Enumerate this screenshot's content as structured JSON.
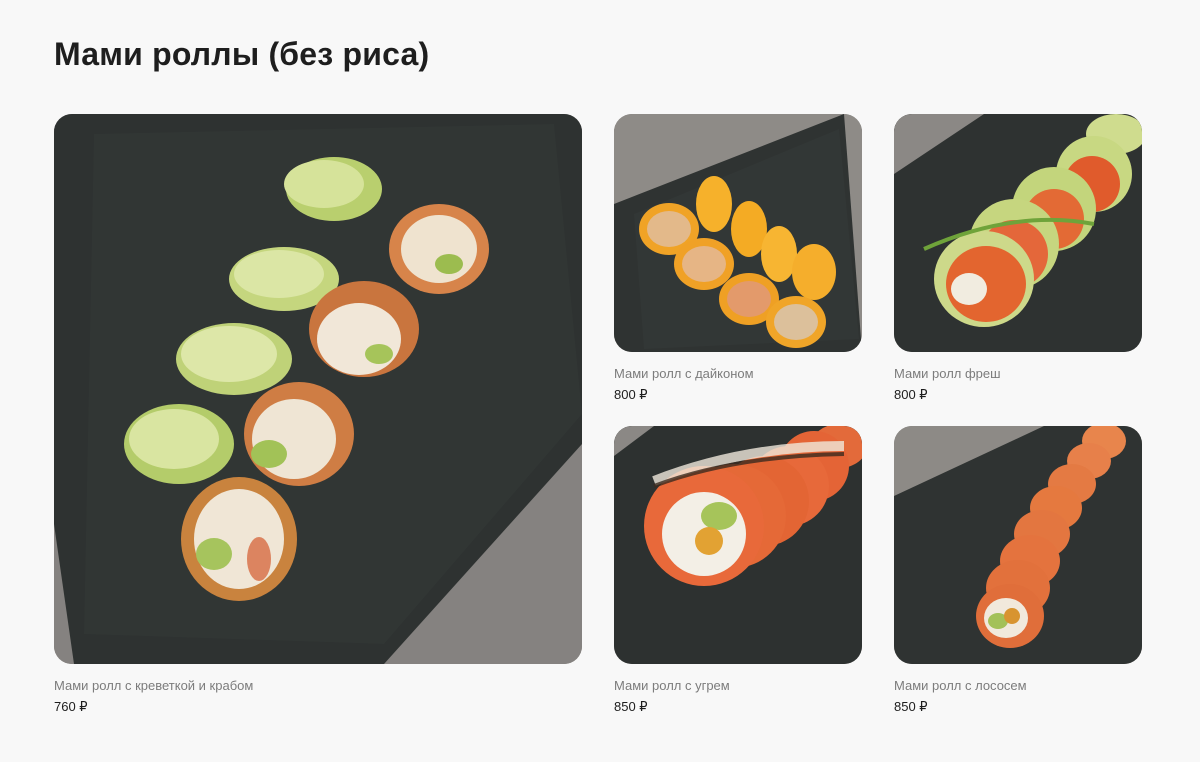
{
  "section": {
    "title": "Мами роллы (без риса)"
  },
  "products": [
    {
      "name": "Мами ролл с креветкой и крабом",
      "price": "760 ₽",
      "image": "shrimp-crab-roll-photo"
    },
    {
      "name": "Мами ролл с дайконом",
      "price": "800 ₽",
      "image": "daikon-roll-photo"
    },
    {
      "name": "Мами ролл фреш",
      "price": "800 ₽",
      "image": "fresh-roll-photo"
    },
    {
      "name": "Мами ролл с угрем",
      "price": "850 ₽",
      "image": "eel-roll-photo"
    },
    {
      "name": "Мами ролл с лососем",
      "price": "850 ₽",
      "image": "salmon-roll-photo"
    }
  ],
  "colors": {
    "background": "#f8f8f8",
    "title": "#1e1e1e",
    "product_name": "#7c7c7c",
    "price": "#1d1d1d",
    "slate": "#2f3332",
    "concrete": "#8a8784"
  }
}
